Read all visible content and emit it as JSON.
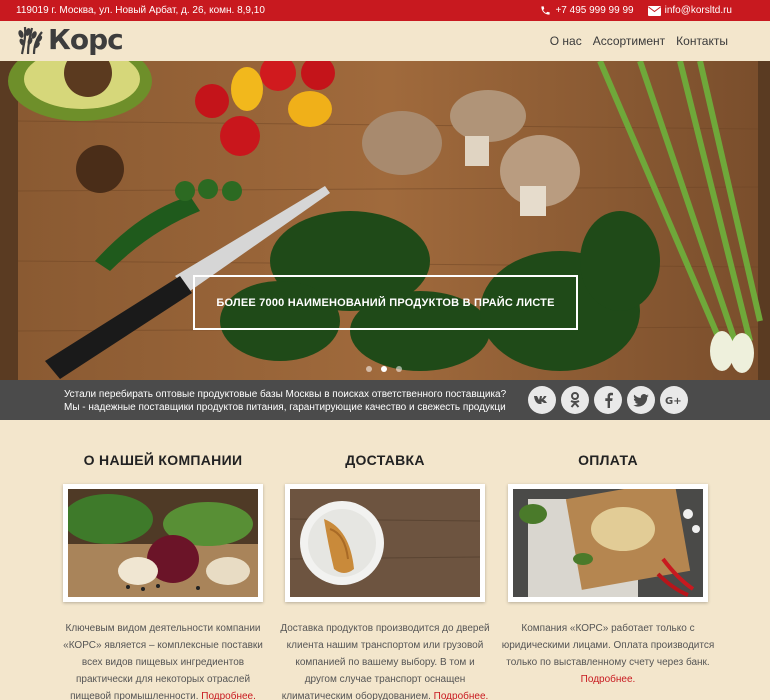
{
  "topbar": {
    "address": "119019 г. Москва, ул. Новый Арбат, д. 26, комн. 8,9,10",
    "phone": "+7 495 999 99 99",
    "email": "info@korsltd.ru"
  },
  "header": {
    "logo_text": "Корс",
    "nav": [
      "О нас",
      "Ассортимент",
      "Контакты"
    ]
  },
  "hero": {
    "caption": "БОЛЕЕ 7000 НАИМЕНОВАНИЙ ПРОДУКТОВ В ПРАЙС ЛИСТЕ",
    "slides": 3,
    "active_slide": 0
  },
  "strip": {
    "line1": "Устали перебирать оптовые продуктовые базы Москвы в поисках ответственного поставщика?",
    "line2": "Мы - надежные поставщики продуктов питания, гарантирующие качество и свежесть продукци",
    "socials": [
      "vk-icon",
      "odnoklassniki-icon",
      "facebook-icon",
      "twitter-icon",
      "google-plus-icon"
    ]
  },
  "columns": [
    {
      "title": "О НАШЕЙ КОМПАНИИ",
      "text": "Ключевым видом деятельности компании «КОРС» является – комплексные поставки всех видов пищевых ингредиентов практически для некоторых отраслей пищевой промышленности.",
      "more": "Подробнее."
    },
    {
      "title": "ДОСТАВКА",
      "text": "Доставка продуктов производится до дверей клиента нашим транспортом или грузовой компанией по вашему выбору. В том и другом случае транспорт оснащен климатическим оборудованием.",
      "more": "Подробнее."
    },
    {
      "title": "ОПЛАТА",
      "text": "Компания «КОРС» работает только с юридическими лицами. Оплата производится только по выставленному счету через банк.",
      "more": "Подробнее."
    }
  ],
  "colors": {
    "accent": "#c8191f",
    "background": "#f3e6cc",
    "strip": "#4b4b4b"
  }
}
